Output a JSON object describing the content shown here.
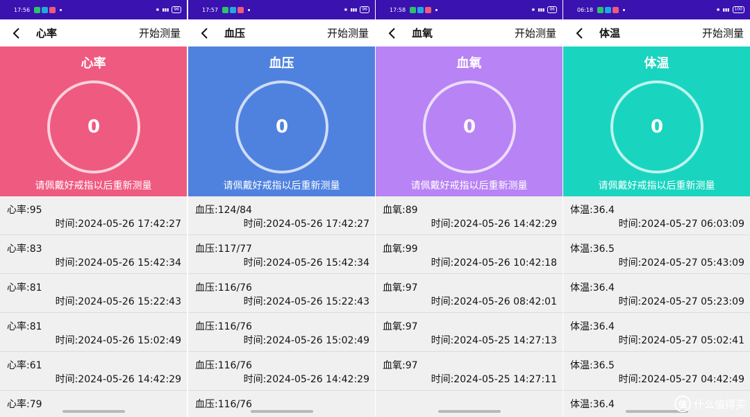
{
  "common": {
    "action_label": "开始测量",
    "hint": "请佩戴好戒指以后重新测量"
  },
  "screens": [
    {
      "status_time": "17:56",
      "battery": "96",
      "title": "心率",
      "hero_title": "心率",
      "gauge_value": "0",
      "hero_color": "#ef5a80",
      "records": [
        {
          "value": "心率:95",
          "time": "时间:2024-05-26 17:42:27"
        },
        {
          "value": "心率:83",
          "time": "时间:2024-05-26 15:42:34"
        },
        {
          "value": "心率:81",
          "time": "时间:2024-05-26 15:22:43"
        },
        {
          "value": "心率:81",
          "time": "时间:2024-05-26 15:02:49"
        },
        {
          "value": "心率:61",
          "time": "时间:2024-05-26 14:42:29"
        },
        {
          "value": "心率:79",
          "time": ""
        }
      ]
    },
    {
      "status_time": "17:57",
      "battery": "96",
      "title": "血压",
      "hero_title": "血压",
      "gauge_value": "0",
      "hero_color": "#4f82df",
      "records": [
        {
          "value": "血压:124/84",
          "time": "时间:2024-05-26 17:42:27"
        },
        {
          "value": "血压:117/77",
          "time": "时间:2024-05-26 15:42:34"
        },
        {
          "value": "血压:116/76",
          "time": "时间:2024-05-26 15:22:43"
        },
        {
          "value": "血压:116/76",
          "time": "时间:2024-05-26 15:02:49"
        },
        {
          "value": "血压:116/76",
          "time": "时间:2024-05-26 14:42:29"
        },
        {
          "value": "血压:116/76",
          "time": ""
        }
      ]
    },
    {
      "status_time": "17:58",
      "battery": "96",
      "title": "血氧",
      "hero_title": "血氧",
      "gauge_value": "0",
      "hero_color": "#b883f5",
      "records": [
        {
          "value": "血氧:89",
          "time": "时间:2024-05-26 14:42:29"
        },
        {
          "value": "血氧:99",
          "time": "时间:2024-05-26 10:42:18"
        },
        {
          "value": "血氧:97",
          "time": "时间:2024-05-26 08:42:01"
        },
        {
          "value": "血氧:97",
          "time": "时间:2024-05-25 14:27:13"
        },
        {
          "value": "血氧:97",
          "time": "时间:2024-05-25 14:27:11"
        }
      ]
    },
    {
      "status_time": "06:18",
      "battery": "100",
      "title": "体温",
      "hero_title": "体温",
      "gauge_value": "0",
      "hero_color": "#19d5c0",
      "records": [
        {
          "value": "体温:36.4",
          "time": "时间:2024-05-27 06:03:09"
        },
        {
          "value": "体温:36.5",
          "time": "时间:2024-05-27 05:43:09"
        },
        {
          "value": "体温:36.4",
          "time": "时间:2024-05-27 05:23:09"
        },
        {
          "value": "体温:36.4",
          "time": "时间:2024-05-27 05:02:41"
        },
        {
          "value": "体温:36.5",
          "time": "时间:2024-05-27 04:42:49"
        },
        {
          "value": "体温:36.4",
          "time": ""
        }
      ]
    }
  ],
  "watermark": {
    "badge": "值",
    "text": "什么值得买"
  }
}
